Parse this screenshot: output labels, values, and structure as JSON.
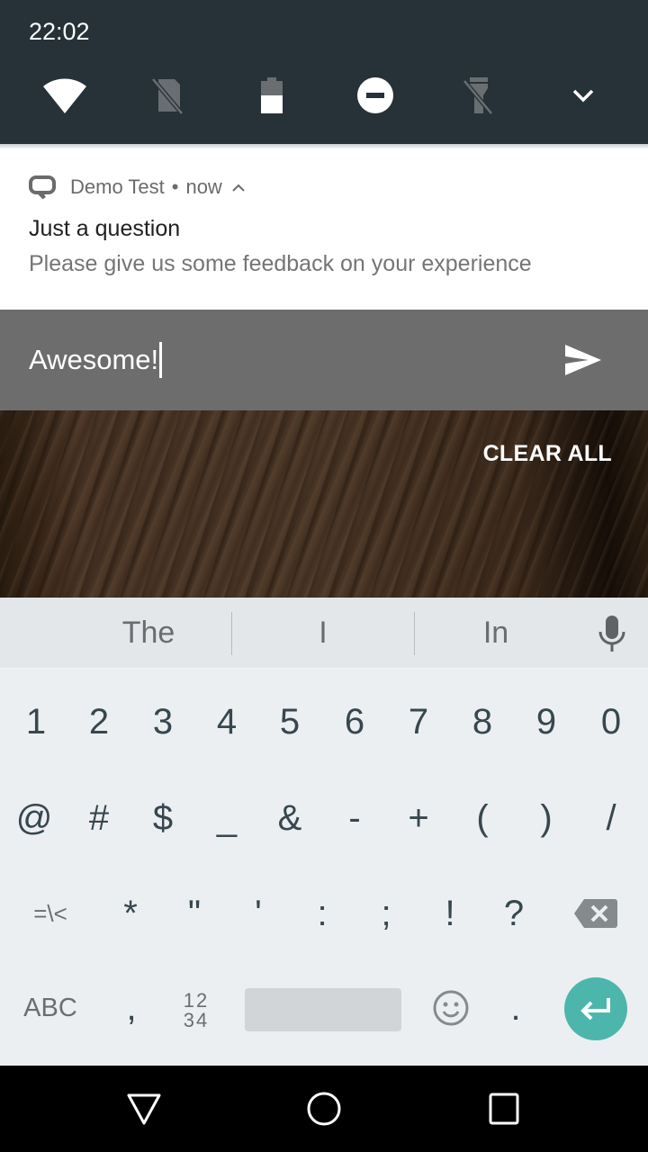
{
  "status": {
    "time": "22:02"
  },
  "quick_settings": {
    "tiles": [
      {
        "name": "wifi",
        "icon": "wifi-icon",
        "state": "on"
      },
      {
        "name": "mobile-data",
        "icon": "no-sim-icon",
        "state": "off"
      },
      {
        "name": "battery",
        "icon": "battery-icon",
        "state": "on"
      },
      {
        "name": "do-not-disturb",
        "icon": "do-not-disturb-icon",
        "state": "on"
      },
      {
        "name": "flashlight",
        "icon": "flashlight-off-icon",
        "state": "off"
      },
      {
        "name": "expand",
        "icon": "chevron-down-icon",
        "state": "on"
      }
    ]
  },
  "notification": {
    "app_name": "Demo Test",
    "separator": "•",
    "time": "now",
    "title": "Just a question",
    "text": "Please give us some feedback on your experience",
    "reply_value": "Awesome!",
    "send_icon": "send-icon"
  },
  "shade": {
    "clear_all_label": "CLEAR ALL"
  },
  "keyboard": {
    "suggestions": [
      "The",
      "I",
      "In"
    ],
    "row1": [
      "1",
      "2",
      "3",
      "4",
      "5",
      "6",
      "7",
      "8",
      "9",
      "0"
    ],
    "row2": [
      "@",
      "#",
      "$",
      "_",
      "&",
      "-",
      "+",
      "(",
      ")",
      "/"
    ],
    "row3": [
      "=\\<",
      "*",
      "\"",
      "'",
      ":",
      ";",
      "!",
      "?"
    ],
    "row4": {
      "abc": "ABC",
      "comma": ",",
      "numpad_top": "12",
      "numpad_bottom": "34",
      "period": "."
    },
    "accent_color": "#4db6ac"
  },
  "navbar": {
    "buttons": [
      "back",
      "home",
      "recents"
    ]
  }
}
